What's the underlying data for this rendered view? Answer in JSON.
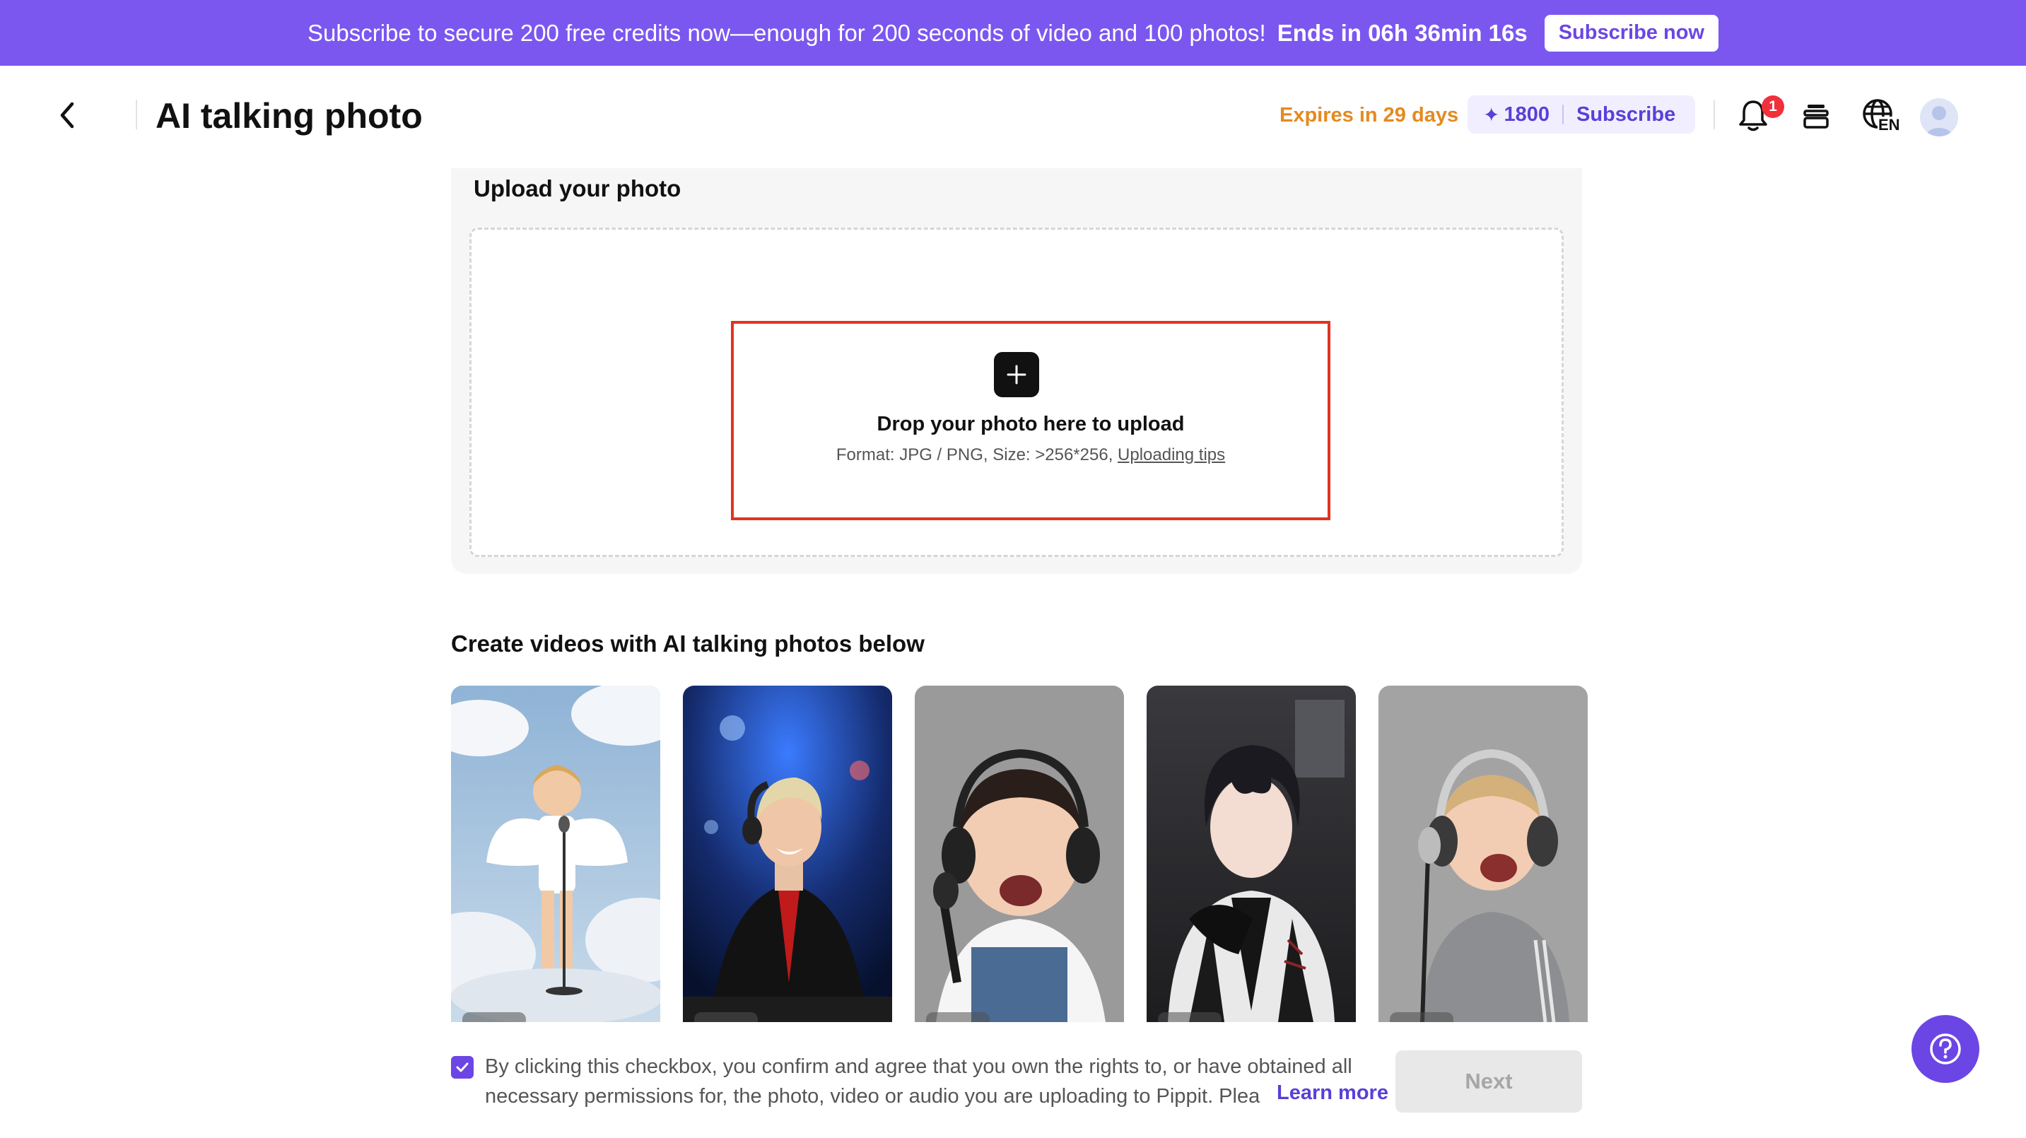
{
  "banner": {
    "message": "Subscribe to secure 200 free credits now—enough for 200 seconds of video and 100 photos!",
    "ends": "Ends in 06h 36min 16s",
    "subscribe_label": "Subscribe now",
    "color": "#7b57f0"
  },
  "header": {
    "back_icon": "chevron-left-icon",
    "title": "AI talking photo",
    "expires": "Expires in 29 days",
    "credits": "1800",
    "subscribe_label": "Subscribe",
    "notification_count": "1",
    "language": "EN",
    "icons": [
      "bell-icon",
      "stack-icon",
      "globe-icon",
      "avatar"
    ]
  },
  "upload": {
    "title": "Upload your photo",
    "drop_title": "Drop your photo here to upload",
    "format_text": "Format: JPG / PNG, Size: >256*256, ",
    "tips_link": "Uploading tips",
    "highlight_color": "#e0341f"
  },
  "gallery": {
    "title": "Create videos with AI talking photos below",
    "items": [
      {
        "name": "angel-toddler-with-microphone"
      },
      {
        "name": "young-man-dj-headphones"
      },
      {
        "name": "baby-with-headphones-and-microphone"
      },
      {
        "name": "anime-style-young-man"
      },
      {
        "name": "toddler-singing-with-headphones"
      }
    ]
  },
  "footer": {
    "checkbox_checked": true,
    "consent_line1": "By clicking this checkbox, you confirm and agree that you own the rights to, or have obtained all",
    "consent_line2": "necessary permissions for, the photo, video or audio you are uploading to Pippit. Plea",
    "learn_more": "Learn more",
    "next_label": "Next"
  },
  "accent_color": "#6b46e4"
}
